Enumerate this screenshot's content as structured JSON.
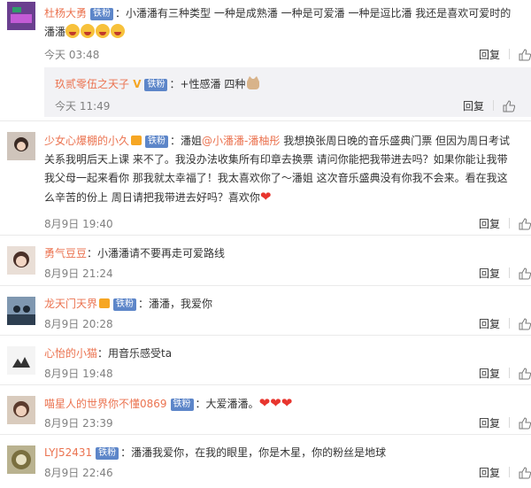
{
  "labels": {
    "reply": "回复",
    "fan_badge": "铁粉"
  },
  "comments": [
    {
      "user": "杜杨大勇",
      "text": "：小潘潘有三种类型 一种是成熟潘 一种是可爱潘 一种是逗比潘 我还是喜欢可爱时的潘潘",
      "time": "今天 03:48",
      "reply": {
        "user": "玖贰零伍之天子",
        "text": "：+性感潘 四种",
        "time": "今天 11:49"
      }
    },
    {
      "user": "少女心爆棚的小久",
      "mention": "@小潘潘-潘柚彤",
      "prefix": "：潘姐",
      "text": " 我想换张周日晚的音乐盛典门票 但因为周日考试关系我明后天上课 来不了。我没办法收集所有印章去换票 请问你能把我带进去吗？如果你能让我带我父母一起来看你 那我就太幸福了！我太喜欢你了～潘姐 这次音乐盛典没有你我不会来。看在我这么辛苦的份上 周日请把我带进去好吗？喜欢你",
      "time": "8月9日 19:40"
    },
    {
      "user": "勇气豆豆",
      "text": "：小潘潘请不要再走可爱路线",
      "time": "8月9日 21:24"
    },
    {
      "user": "龙天门天界",
      "text": "：潘潘，我爱你",
      "time": "8月9日 20:28"
    },
    {
      "user": "心怡的小猫",
      "text": "：用音乐感受ta",
      "time": "8月9日 19:48"
    },
    {
      "user": "喵星人的世界你不懂0869",
      "text": "：大爱潘潘。",
      "time": "8月9日 23:39"
    },
    {
      "user": "LYJ52431",
      "text": "：潘潘我爱你，在我的眼里，你是木星，你的粉丝是地球",
      "time": "8月9日 22:46"
    }
  ],
  "colors": {
    "username": "#eb7350",
    "badge": "#5d86c9",
    "heart": "#e8352e",
    "meta": "#808080"
  }
}
